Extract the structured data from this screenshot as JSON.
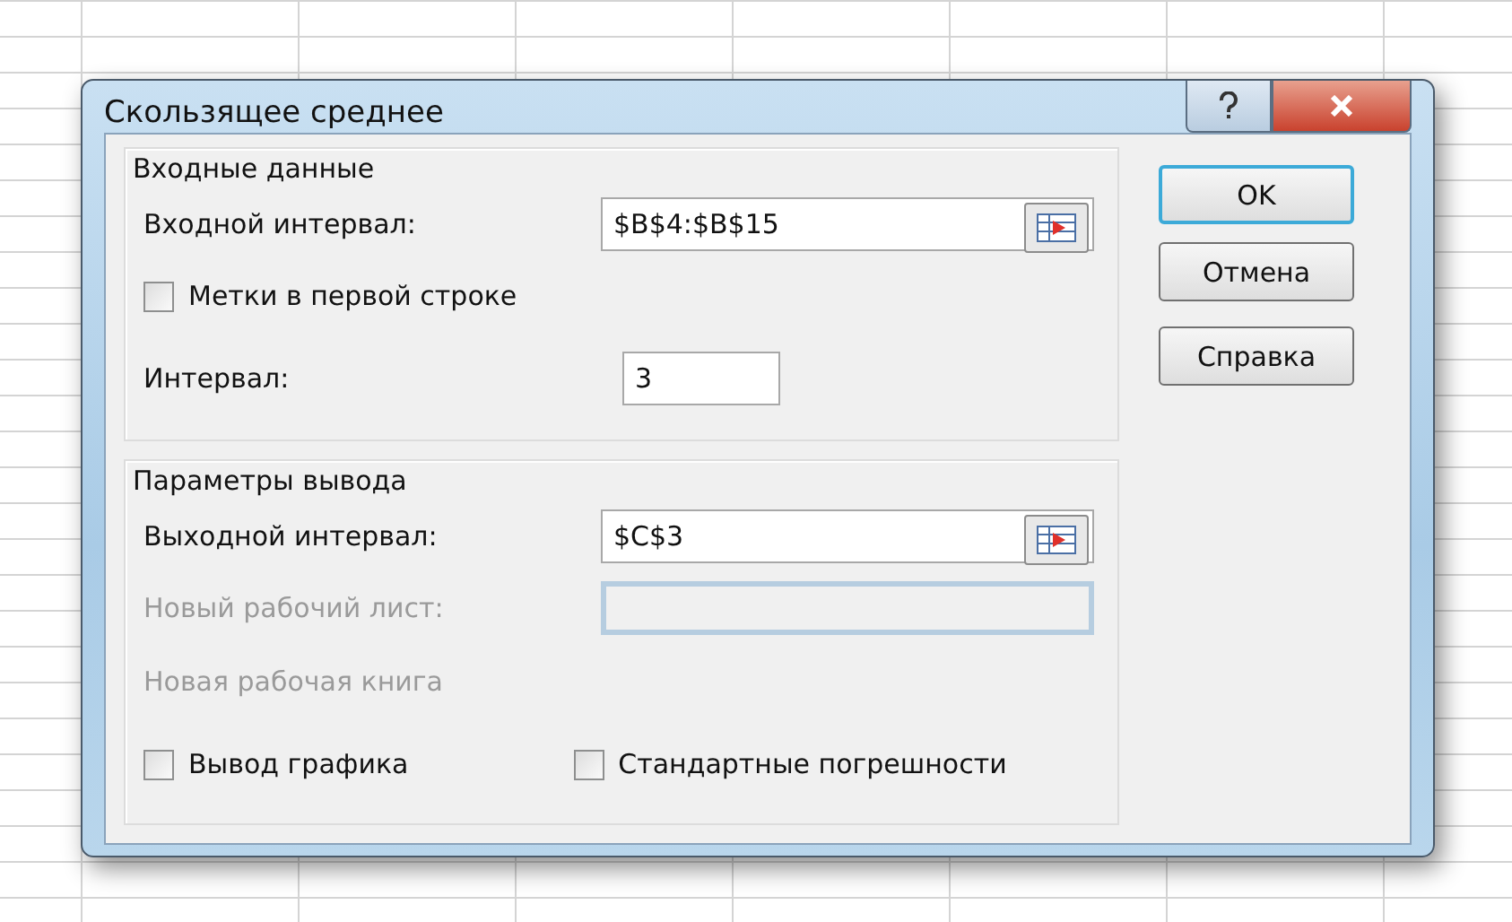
{
  "window": {
    "title": "Скользящее среднее"
  },
  "groups": [
    {
      "title": "Входные данные",
      "rows": [
        {
          "kind": "range",
          "label": "Входной интервал:",
          "value": "$B$4:$B$15",
          "disabled": false
        },
        {
          "kind": "checkbox",
          "label": "Метки в первой строке",
          "checked": false
        },
        {
          "kind": "short",
          "label": "Интервал:",
          "value": "3"
        }
      ]
    },
    {
      "title": "Параметры вывода",
      "rows": [
        {
          "kind": "range",
          "label": "Выходной интервал:",
          "value": "$C$3",
          "disabled": false
        },
        {
          "kind": "range",
          "label": "Новый рабочий лист:",
          "disabled": true
        },
        {
          "kind": "label",
          "label": "Новая рабочая книга",
          "disabled": true
        },
        {
          "kind": "checkboxes",
          "items": [
            {
              "label": "Вывод графика",
              "checked": false
            },
            {
              "label": "Стандартные погрешности",
              "checked": false
            }
          ]
        }
      ]
    }
  ],
  "buttons": [
    {
      "label": "OK",
      "default": true
    },
    {
      "label": "Отмена",
      "default": false
    },
    {
      "label": "Справка",
      "default": false
    }
  ]
}
